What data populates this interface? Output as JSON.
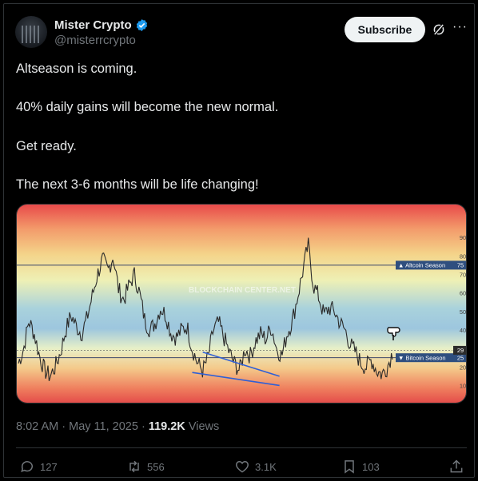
{
  "author": {
    "name": "Mister Crypto",
    "handle": "@misterrcrypto",
    "subscribe_label": "Subscribe"
  },
  "tweet": {
    "lines": [
      "Altseason is coming.",
      "40% daily gains will become the new normal.",
      "Get ready.",
      "The next 3-6 months will be life changing!"
    ],
    "time": "8:02 AM",
    "date": "May 11, 2025",
    "views_count": "119.2K",
    "views_label": "Views"
  },
  "actions": {
    "replies": "127",
    "reposts": "556",
    "likes": "3.1K",
    "bookmarks": "103"
  },
  "icons": [
    "verified-badge-icon",
    "grok-icon",
    "more-icon",
    "reply-icon",
    "repost-icon",
    "like-icon",
    "bookmark-icon",
    "share-icon",
    "pointing-hand-icon"
  ],
  "chart_data": {
    "type": "line",
    "watermark": "BLOCKCHAIN CENTER.NET",
    "y_ticks": [
      "10",
      "20",
      "30",
      "40",
      "50",
      "60",
      "70",
      "80",
      "90"
    ],
    "ylim": [
      5,
      100
    ],
    "altcoin_line": {
      "value": 75,
      "label": "▲ Altcoin Season",
      "value_label": "75"
    },
    "bitcoin_line": {
      "value": 25,
      "label": "▼ Bitcoin Season",
      "value_label": "25"
    },
    "current": {
      "value": 29,
      "label": "29"
    },
    "top_tick_partial": "10",
    "series": [
      {
        "values": [
          22,
          30,
          45,
          38,
          26,
          18,
          15,
          20,
          28,
          40,
          48,
          42,
          38,
          46,
          58,
          70,
          78,
          72,
          80,
          62,
          56,
          64,
          70,
          60,
          45,
          40,
          44,
          52,
          48,
          38,
          36,
          40,
          42,
          30,
          22,
          18,
          25,
          40,
          44,
          36,
          28,
          22,
          18,
          30,
          26,
          34,
          38,
          35,
          42,
          30,
          26,
          38,
          45,
          58,
          72,
          86,
          64,
          58,
          48,
          52,
          50,
          44,
          40,
          32,
          28,
          22,
          20,
          24,
          18,
          16,
          20,
          28
        ]
      }
    ],
    "wedge": {
      "upper": [
        [
          35,
          28
        ],
        [
          45,
          15
        ]
      ],
      "lower": [
        [
          33,
          17
        ],
        [
          45,
          10
        ]
      ]
    }
  }
}
